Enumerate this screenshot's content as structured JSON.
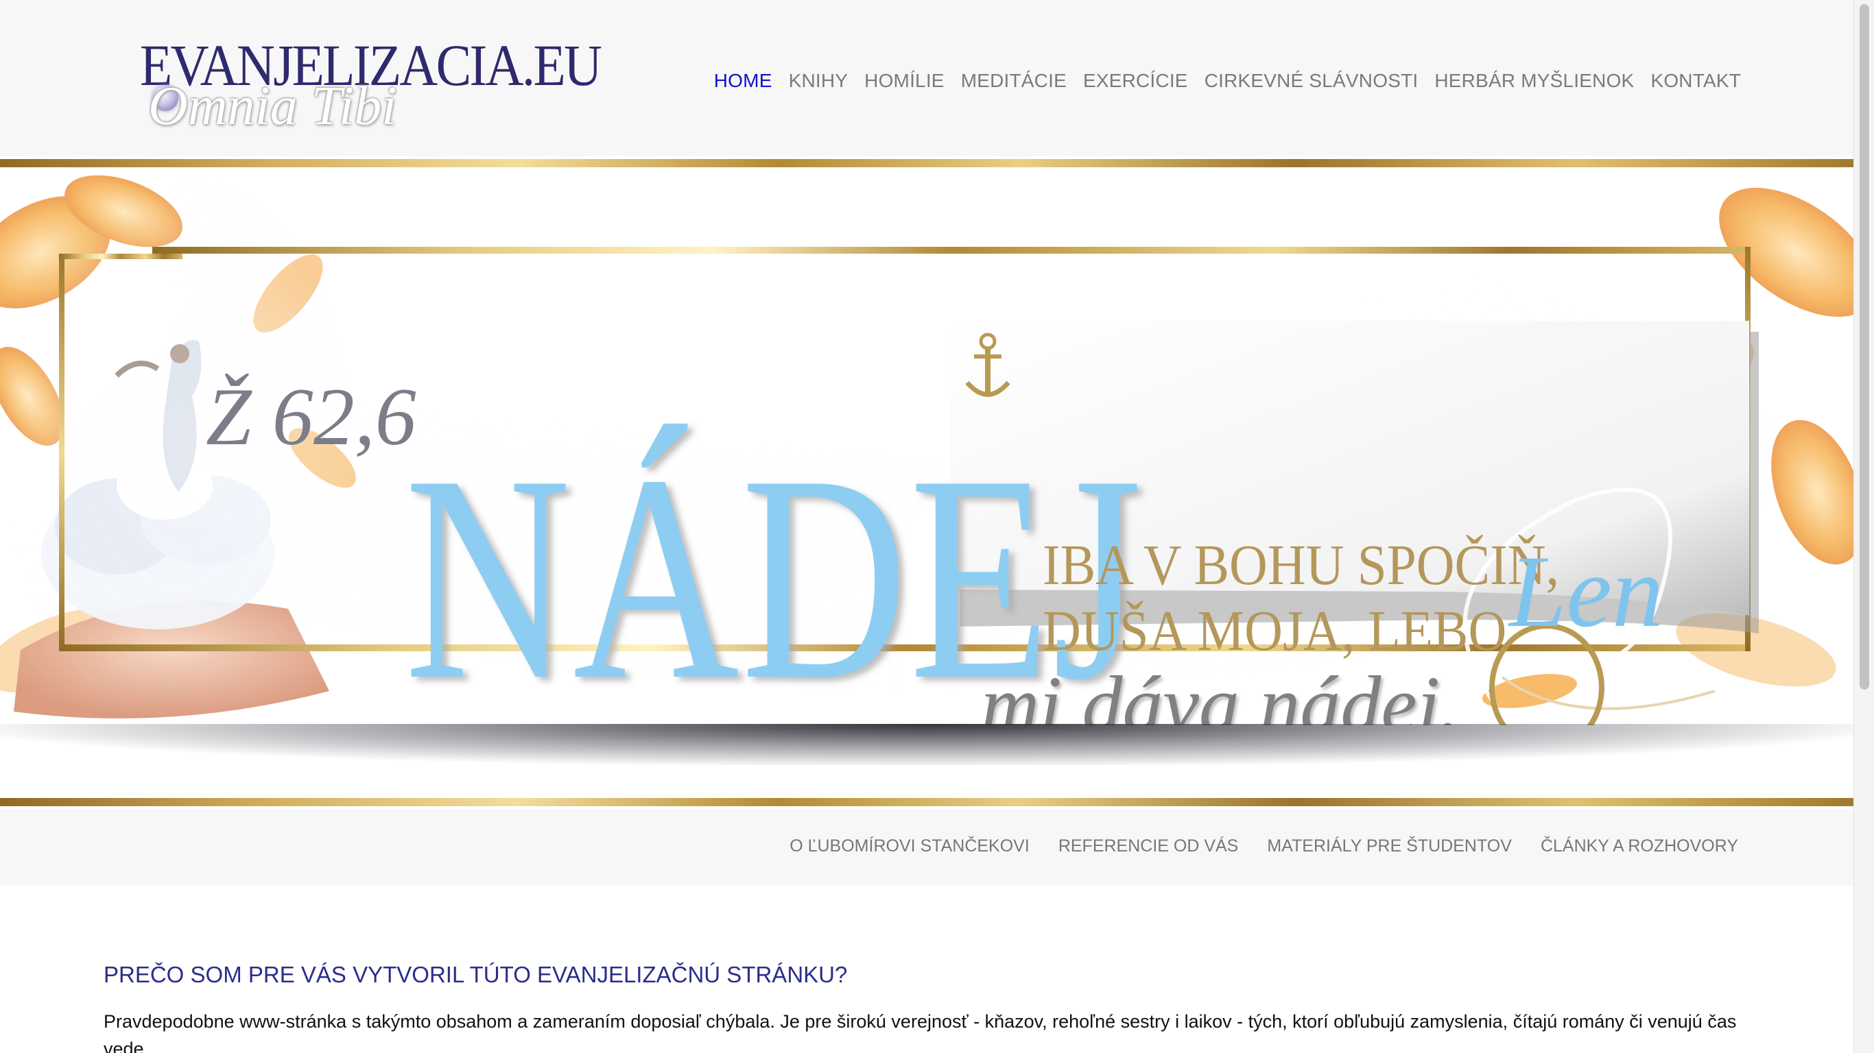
{
  "logo": {
    "main": "EVANJELIZACIA.EU",
    "sub": "Omnia Tibi"
  },
  "nav": {
    "items": [
      {
        "label": "HOME",
        "active": true
      },
      {
        "label": "KNIHY",
        "active": false
      },
      {
        "label": "HOMÍLIE",
        "active": false
      },
      {
        "label": "MEDITÁCIE",
        "active": false
      },
      {
        "label": "EXERCÍCIE",
        "active": false
      },
      {
        "label": "CIRKEVNÉ SLÁVNOSTI",
        "active": false
      },
      {
        "label": "HERBÁR MYŠLIENOK",
        "active": false
      },
      {
        "label": "KONTAKT",
        "active": false
      }
    ],
    "active_color": "#1010cc",
    "text_color": "#7a7a7a"
  },
  "banner": {
    "reference": "Ž 62,6",
    "title": "NÁDEJ",
    "line1": "IBA V BOHU SPOČIŇ,",
    "line2": "DUŠA MOJA, LEBO",
    "line3": "mi dáva nádej.",
    "len": "Len",
    "title_color": "#8ecdf2",
    "gold_color": "#b4975a"
  },
  "subnav": {
    "items": [
      "O ĽUBOMÍROVI STANČEKOVI",
      "REFERENCIE OD VÁS",
      "MATERIÁLY PRE ŠTUDENTOV",
      "ČLÁNKY A ROZHOVORY"
    ]
  },
  "content": {
    "heading": "PREČO SOM PRE VÁS VYTVORIL TÚTO EVANJELIZAČNÚ STRÁNKU?",
    "paragraph": "Pravdepodobne www-stránka s takýmto obsahom a zameraním doposiaľ chýbala. Je pre širokú verejnosť - kňazov, rehoľné sestry i laikov - tých, ktorí obľubujú zamyslenia, čítajú romány či venujú čas vede.",
    "heading_color": "#2c2c8c"
  }
}
